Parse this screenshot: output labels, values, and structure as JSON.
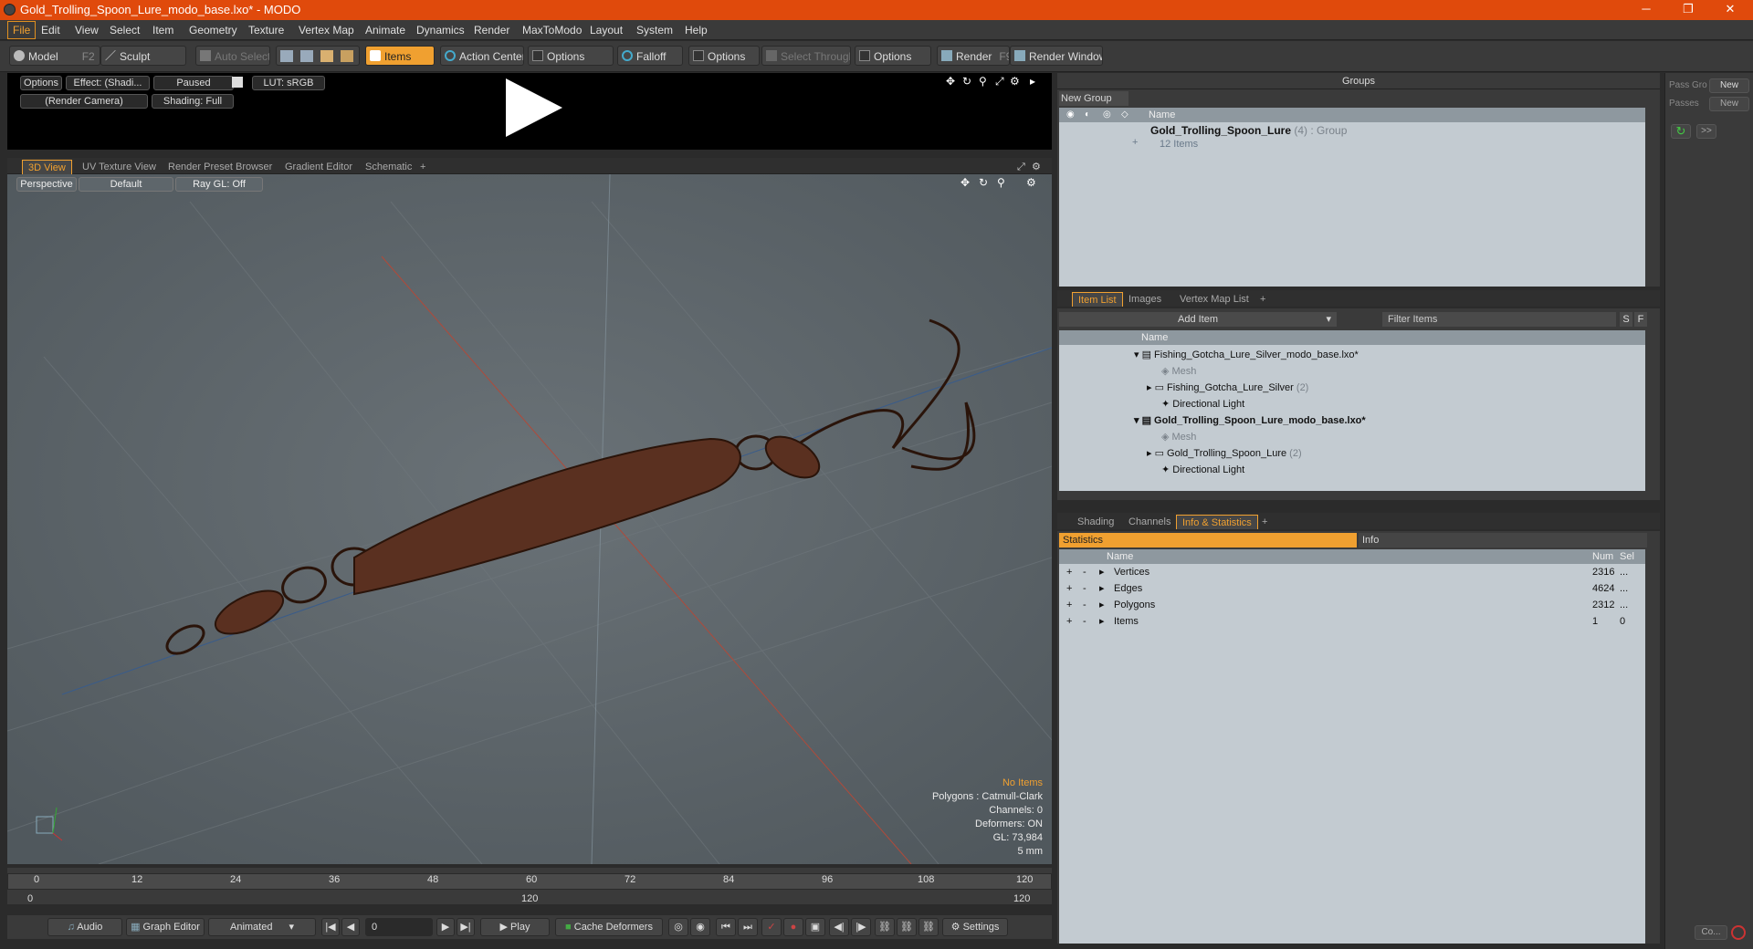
{
  "window": {
    "title": "Gold_Trolling_Spoon_Lure_modo_base.lxo* - MODO",
    "minimize": "─",
    "maximize": "❐",
    "close": "✕"
  },
  "menu": [
    "File",
    "Edit",
    "View",
    "Select",
    "Item",
    "Geometry",
    "Texture",
    "Vertex Map",
    "Animate",
    "Dynamics",
    "Render",
    "MaxToModo",
    "Layout",
    "System",
    "Help"
  ],
  "toolbar": {
    "model": "Model",
    "model_key": "F2",
    "sculpt": "Sculpt",
    "auto_select": "Auto Select",
    "items": "Items",
    "action_center": "Action Center",
    "options1": "Options",
    "falloff": "Falloff",
    "options2": "Options",
    "select_through": "Select Through",
    "options3": "Options",
    "render": "Render",
    "render_key": "F9",
    "render_window": "Render Window"
  },
  "preview": {
    "options": "Options",
    "effect": "Effect: (Shadi...",
    "paused": "Paused",
    "lut": "LUT: sRGB",
    "camera": "(Render Camera)",
    "shading": "Shading: Full"
  },
  "viewtabs": [
    "3D View",
    "UV Texture View",
    "Render Preset Browser",
    "Gradient Editor",
    "Schematic",
    "+"
  ],
  "viewport": {
    "perspective": "Perspective",
    "default": "Default",
    "raygl": "Ray GL: Off",
    "info": {
      "no_items": "No Items",
      "polygons": "Polygons : Catmull-Clark",
      "channels": "Channels: 0",
      "deformers": "Deformers: ON",
      "gl": "GL: 73,984",
      "scale": "5 mm"
    }
  },
  "timeline": {
    "ticks": [
      "0",
      "12",
      "24",
      "36",
      "48",
      "60",
      "72",
      "84",
      "96",
      "108",
      "120"
    ],
    "lower_left": "0",
    "lower_mid": "120",
    "lower_right": "120"
  },
  "bottombar": {
    "audio": "Audio",
    "graph_editor": "Graph Editor",
    "animated": "Animated",
    "frame": "0",
    "play": "Play",
    "cache": "Cache Deformers",
    "settings": "Settings"
  },
  "groups": {
    "title": "Groups",
    "new_group": "New Group",
    "col_name": "Name",
    "item_name": "Gold_Trolling_Spoon_Lure",
    "item_count": "(4)",
    "item_type": ": Group",
    "item_sub": "12 Items"
  },
  "rightstrip": {
    "pass_group": "Pass Gro",
    "new1": "New",
    "passes": "Passes",
    "new2": "New",
    "arrows": ">>",
    "bottom_btn": "Co..."
  },
  "itemlist": {
    "tabs": [
      "Item List",
      "Images",
      "Vertex Map List",
      "+"
    ],
    "add_item": "Add Item",
    "filter": "Filter Items",
    "s": "S",
    "f": "F",
    "col_name": "Name",
    "rows": [
      {
        "label": "Fishing_Gotcha_Lure_Silver_modo_base.lxo*",
        "count": ""
      },
      {
        "label": "Mesh",
        "count": ""
      },
      {
        "label": "Fishing_Gotcha_Lure_Silver",
        "count": "(2)"
      },
      {
        "label": "Directional Light",
        "count": ""
      },
      {
        "label": "Gold_Trolling_Spoon_Lure_modo_base.lxo*",
        "count": ""
      },
      {
        "label": "Mesh",
        "count": ""
      },
      {
        "label": "Gold_Trolling_Spoon_Lure",
        "count": "(2)"
      },
      {
        "label": "Directional Light",
        "count": ""
      }
    ]
  },
  "stats": {
    "tabs": [
      "Shading",
      "Channels",
      "Info & Statistics",
      "+"
    ],
    "statistics": "Statistics",
    "info": "Info",
    "cols": {
      "name": "Name",
      "num": "Num",
      "sel": "Sel"
    },
    "rows": [
      {
        "name": "Vertices",
        "num": "2316",
        "sel": "..."
      },
      {
        "name": "Edges",
        "num": "4624",
        "sel": "..."
      },
      {
        "name": "Polygons",
        "num": "2312",
        "sel": "..."
      },
      {
        "name": "Items",
        "num": "1",
        "sel": "0"
      }
    ]
  }
}
